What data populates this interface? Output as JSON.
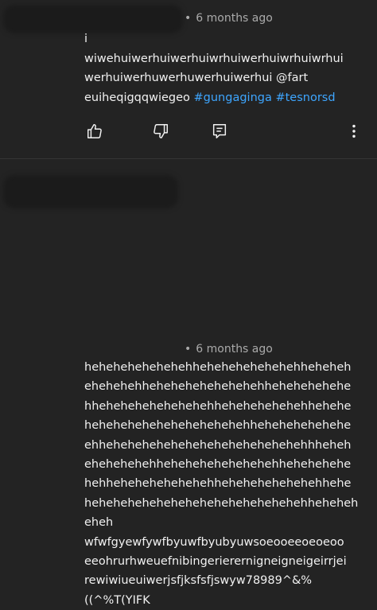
{
  "comments": [
    {
      "time": "6 months ago",
      "separator": "•",
      "lines": [
        "i",
        "wiwehuiwerhuiwerhuiwrhuiwerhuiwrhuiwrhui",
        "werhuiwerhuwerhuwerhuiwerhui"
      ],
      "mention": "@fart",
      "last_line_prefix": "euiheqigqqwiegeo",
      "hashtags": [
        "#gungaginga",
        "#tesnorsd"
      ],
      "actions": {
        "like_icon": "thumbs-up-icon",
        "dislike_icon": "thumbs-down-icon",
        "reply_icon": "reply-comment-icon",
        "more_icon": "more-vertical-icon"
      }
    },
    {
      "time": "6 months ago",
      "separator": "•",
      "lines": [
        "hehehehehehehehhehehehehehehehheheheh",
        "ehehehehhehehehehehehehehhehehehehehe",
        "hhehehehehehehehehhehehehehehehhehehe",
        "hehehehehehehehehehehehhehehehehehehe",
        "ehhehehehehehehehehehehehehehehhheheh",
        "ehehehehehhehehehehehehehehhehehehehe",
        "hehhehehehehehehehhehehehehehehehhehe",
        "hehehehehehehehehehehehehehehehheheheh",
        "eheh",
        "wfwfgyewfywfbyuwfbyubyuwsoeooeeoeoeoo",
        "eeohrurhweuefnibingerierernigneigneigeirrjei",
        "rewiwiueuiwerjsfjksfsfjswyw78989^&%",
        "((^%T(YIFK"
      ]
    }
  ]
}
